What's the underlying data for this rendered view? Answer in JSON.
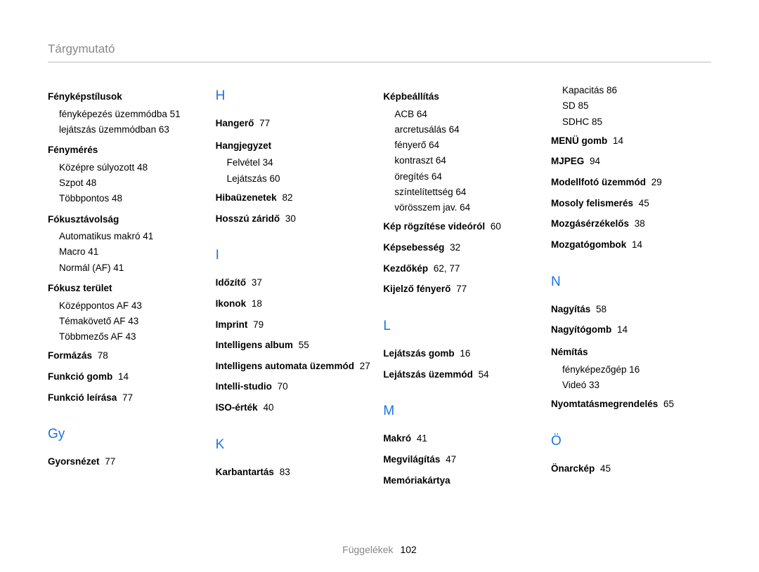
{
  "title": "Tárgymutató",
  "columns": [
    [
      {
        "type": "group",
        "label": "Fényképstílusok",
        "subs": [
          {
            "label": "fényképezés üzemmódba",
            "page": "51"
          },
          {
            "label": "lejátszás üzemmódban",
            "page": "63"
          }
        ]
      },
      {
        "type": "group",
        "label": "Fénymérés",
        "subs": [
          {
            "label": "Középre súlyozott",
            "page": "48"
          },
          {
            "label": "Szpot",
            "page": "48"
          },
          {
            "label": "Többpontos",
            "page": "48"
          }
        ]
      },
      {
        "type": "group",
        "label": "Fókusztávolság",
        "subs": [
          {
            "label": "Automatikus makró",
            "page": "41"
          },
          {
            "label": "Macro",
            "page": "41"
          },
          {
            "label": "Normál (AF)",
            "page": "41"
          }
        ]
      },
      {
        "type": "group",
        "label": "Fókusz terület",
        "subs": [
          {
            "label": "Középpontos AF",
            "page": "43"
          },
          {
            "label": "Témakövető AF",
            "page": "43"
          },
          {
            "label": "Többmezős AF",
            "page": "43"
          }
        ]
      },
      {
        "type": "entry",
        "label": "Formázás",
        "page": "78"
      },
      {
        "type": "entry",
        "label": "Funkció gomb",
        "page": "14"
      },
      {
        "type": "entry",
        "label": "Funkció leírása",
        "page": "77"
      },
      {
        "type": "letter",
        "label": "Gy"
      },
      {
        "type": "entry",
        "label": "Gyorsnézet",
        "page": "77"
      }
    ],
    [
      {
        "type": "letter",
        "label": "H"
      },
      {
        "type": "entry",
        "label": "Hangerő",
        "page": "77"
      },
      {
        "type": "group",
        "label": "Hangjegyzet",
        "subs": [
          {
            "label": "Felvétel",
            "page": "34"
          },
          {
            "label": "Lejátszás",
            "page": "60"
          }
        ]
      },
      {
        "type": "entry",
        "label": "Hibaüzenetek",
        "page": "82"
      },
      {
        "type": "entry",
        "label": "Hosszú záridő",
        "page": "30"
      },
      {
        "type": "letter",
        "label": "I"
      },
      {
        "type": "entry",
        "label": "Időzítő",
        "page": "37"
      },
      {
        "type": "entry",
        "label": "Ikonok",
        "page": "18"
      },
      {
        "type": "entry",
        "label": "Imprint",
        "page": "79"
      },
      {
        "type": "entry",
        "label": "Intelligens album",
        "page": "55"
      },
      {
        "type": "entry",
        "label": "Intelligens automata üzemmód",
        "page": "27"
      },
      {
        "type": "entry",
        "label": "Intelli-studio",
        "page": "70"
      },
      {
        "type": "entry",
        "label": "ISO-érték",
        "page": "40"
      },
      {
        "type": "letter",
        "label": "K"
      },
      {
        "type": "entry",
        "label": "Karbantartás",
        "page": "83"
      }
    ],
    [
      {
        "type": "group",
        "label": "Képbeállítás",
        "subs": [
          {
            "label": "ACB",
            "page": "64"
          },
          {
            "label": "arcretusálás",
            "page": "64"
          },
          {
            "label": "fényerő",
            "page": "64"
          },
          {
            "label": "kontraszt",
            "page": "64"
          },
          {
            "label": "öregítés",
            "page": "64"
          },
          {
            "label": "színtelítettség",
            "page": "64"
          },
          {
            "label": "vörösszem jav.",
            "page": "64"
          }
        ]
      },
      {
        "type": "entry",
        "label": "Kép rögzítése videóról",
        "page": "60"
      },
      {
        "type": "entry",
        "label": "Képsebesség",
        "page": "32"
      },
      {
        "type": "entry",
        "label": "Kezdőkép",
        "page": "62",
        "extra": "77"
      },
      {
        "type": "entry",
        "label": "Kijelző fényerő",
        "page": "77"
      },
      {
        "type": "letter",
        "label": "L"
      },
      {
        "type": "entry",
        "label": "Lejátszás gomb",
        "page": "16"
      },
      {
        "type": "entry",
        "label": "Lejátszás üzemmód",
        "page": "54"
      },
      {
        "type": "letter",
        "label": "M"
      },
      {
        "type": "entry",
        "label": "Makró",
        "page": "41"
      },
      {
        "type": "entry",
        "label": "Megvilágítás",
        "page": "47"
      },
      {
        "type": "entry",
        "label": "Memóriakártya",
        "noPage": true
      }
    ],
    [
      {
        "type": "subonly",
        "subs": [
          {
            "label": "Kapacitás",
            "page": "86"
          },
          {
            "label": "SD",
            "page": "85"
          },
          {
            "label": "SDHC",
            "page": "85"
          }
        ]
      },
      {
        "type": "entry",
        "label": "MENÜ gomb",
        "page": "14"
      },
      {
        "type": "entry",
        "label": "MJPEG",
        "page": "94"
      },
      {
        "type": "entry",
        "label": "Modellfotó üzemmód",
        "page": "29"
      },
      {
        "type": "entry",
        "label": "Mosoly felismerés",
        "page": "45"
      },
      {
        "type": "entry",
        "label": "Mozgásérzékelős",
        "page": "38"
      },
      {
        "type": "entry",
        "label": "Mozgatógombok",
        "page": "14"
      },
      {
        "type": "letter",
        "label": "N"
      },
      {
        "type": "entry",
        "label": "Nagyítás",
        "page": "58"
      },
      {
        "type": "entry",
        "label": "Nagyítógomb",
        "page": "14"
      },
      {
        "type": "group",
        "label": "Némítás",
        "subs": [
          {
            "label": "fényképezőgép",
            "page": "16"
          },
          {
            "label": "Videó",
            "page": "33"
          }
        ]
      },
      {
        "type": "entry",
        "label": "Nyomtatásmegrendelés",
        "page": "65"
      },
      {
        "type": "letter",
        "label": "Ö"
      },
      {
        "type": "entry",
        "label": "Önarckép",
        "page": "45"
      }
    ]
  ],
  "footer": {
    "label": "Függelékek",
    "page": "102"
  }
}
